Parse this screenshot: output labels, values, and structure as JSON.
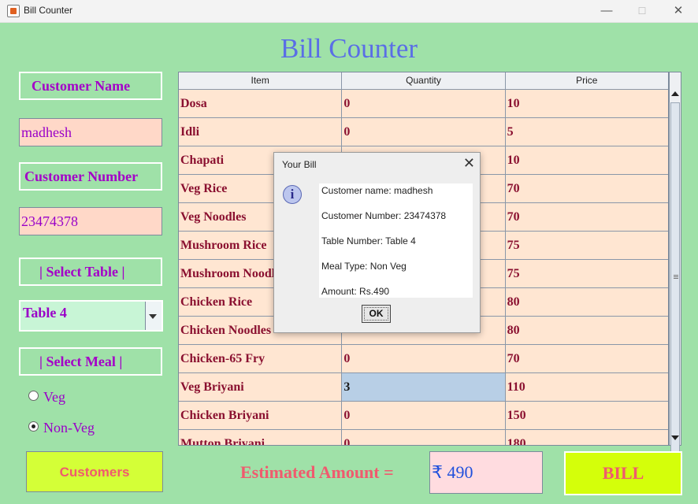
{
  "window": {
    "title": "Bill Counter",
    "minimize": "—",
    "maximize": "☐",
    "close": "✕"
  },
  "heading": "Bill Counter",
  "form": {
    "customer_name_label": "Customer Name",
    "customer_name_value": "madhesh",
    "customer_number_label": "Customer Number",
    "customer_number_value": "23474378",
    "select_table_label": "| Select Table |",
    "table_value": "Table 4",
    "select_meal_label": "| Select Meal |",
    "meal_options": [
      "Veg",
      "Non-Veg"
    ],
    "meal_selected": "Non-Veg"
  },
  "table": {
    "headers": [
      "Item",
      "Quantity",
      "Price"
    ],
    "rows": [
      [
        "Dosa",
        "0",
        "10"
      ],
      [
        "Idli",
        "0",
        "5"
      ],
      [
        "Chapati",
        "",
        "10"
      ],
      [
        "Veg Rice",
        "",
        "70"
      ],
      [
        "Veg Noodles",
        "",
        "70"
      ],
      [
        "Mushroom Rice",
        "",
        "75"
      ],
      [
        "Mushroom Noodle",
        "",
        "75"
      ],
      [
        "Chicken Rice",
        "",
        "80"
      ],
      [
        "Chicken Noodles",
        "",
        "80"
      ],
      [
        "Chicken-65 Fry",
        "0",
        "70"
      ],
      [
        "Veg Briyani",
        "3",
        "110"
      ],
      [
        "Chicken Briyani",
        "0",
        "150"
      ],
      [
        "Mutton Briyani",
        "0",
        "180"
      ]
    ],
    "selected_row": 10
  },
  "dialog": {
    "title": "Your Bill",
    "close": "✕",
    "icon": "info-icon",
    "lines": [
      "Customer name: madhesh",
      "Customer Number: 23474378",
      "Table Number: Table 4",
      "Meal Type: Non Veg",
      "Amount: Rs.490"
    ],
    "ok": "OK"
  },
  "footer": {
    "customers_button": "Customers",
    "estimated_label": "Estimated Amount =",
    "amount_value": "₹ 490",
    "bill_button": "BILL"
  },
  "colors": {
    "background": "#9fe1a8",
    "heading": "#5a6ee6",
    "label": "#a400c8",
    "table_text": "#8a1030",
    "accent": "#f05a6e",
    "button_bg": "#d4ff37"
  }
}
